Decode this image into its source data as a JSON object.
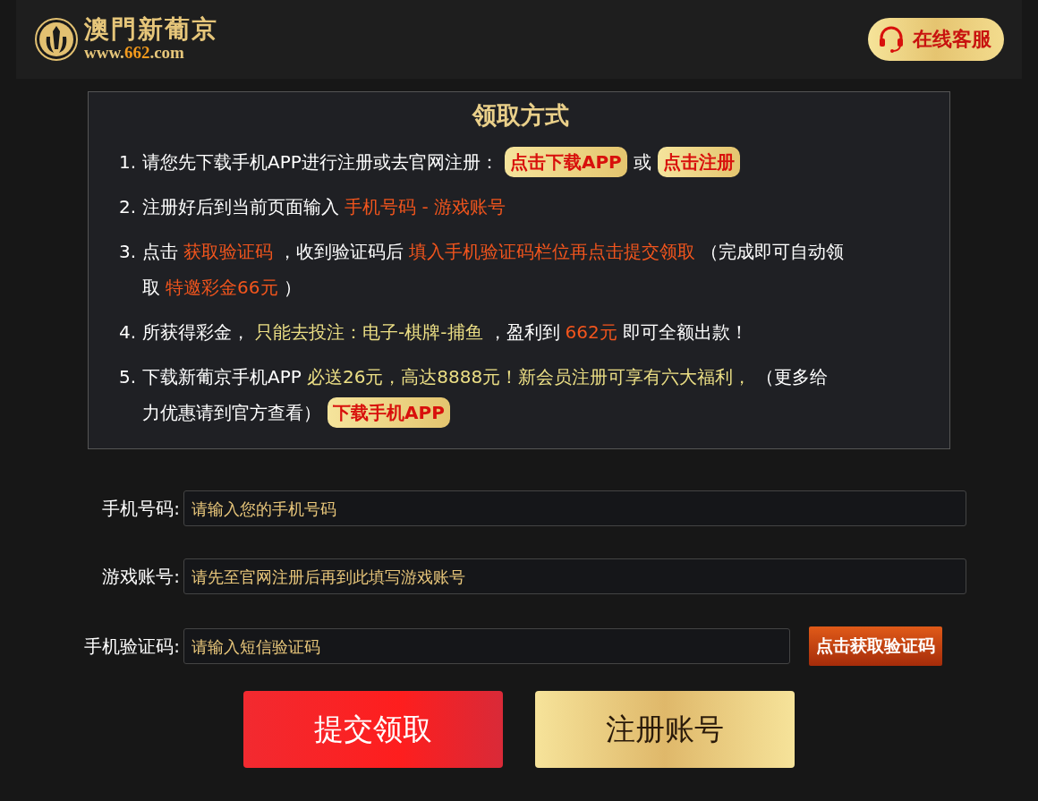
{
  "header": {
    "logo": {
      "name": "澳門新葡京",
      "url": [
        {
          "text": "www.",
          "kind": "plain"
        },
        {
          "text": "662",
          "kind": "accent"
        },
        {
          "text": ".com",
          "kind": "plain"
        }
      ]
    },
    "support_button": "在线客服"
  },
  "instructions": {
    "title": "领取方式",
    "steps": [
      {
        "number": "1.",
        "lines": [
          [
            {
              "kind": "plain",
              "text": "请您先下载手机APP进行注册或去官网注册："
            },
            {
              "kind": "button",
              "text": "点击下载APP"
            },
            {
              "kind": "plain",
              "text": "或"
            },
            {
              "kind": "button",
              "text": "点击注册"
            }
          ]
        ]
      },
      {
        "number": "2.",
        "lines": [
          [
            {
              "kind": "plain",
              "text": "注册好后到当前页面输入"
            },
            {
              "kind": "orange",
              "text": "手机号码 - 游戏账号"
            }
          ]
        ]
      },
      {
        "number": "3.",
        "lines": [
          [
            {
              "kind": "plain",
              "text": "点击"
            },
            {
              "kind": "orange",
              "text": "获取验证码"
            },
            {
              "kind": "plain",
              "text": "，收到验证码后"
            },
            {
              "kind": "orange",
              "text": "填入手机验证码栏位再点击提交领取"
            },
            {
              "kind": "plain",
              "text": "（完成即可自动领"
            }
          ],
          [
            {
              "kind": "plain",
              "text": "取"
            },
            {
              "kind": "orange",
              "text": "特邀彩金66元"
            },
            {
              "kind": "plain",
              "text": "）"
            }
          ]
        ]
      },
      {
        "number": "4.",
        "lines": [
          [
            {
              "kind": "plain",
              "text": "所获得彩金，"
            },
            {
              "kind": "yellow",
              "text": "只能去投注：电子-棋牌-捕鱼"
            },
            {
              "kind": "plain",
              "text": "，盈利到"
            },
            {
              "kind": "orange",
              "text": "662元"
            },
            {
              "kind": "plain",
              "text": "即可全额出款！"
            }
          ]
        ]
      },
      {
        "number": "5.",
        "lines": [
          [
            {
              "kind": "plain",
              "text": "下载新葡京手机APP"
            },
            {
              "kind": "yellow",
              "text": "必送26元，高达8888元！新会员注册可享有六大福利，"
            },
            {
              "kind": "plain",
              "text": "（更多给"
            }
          ],
          [
            {
              "kind": "plain",
              "text": "力优惠请到官方查看）"
            },
            {
              "kind": "button",
              "text": "下载手机APP"
            }
          ]
        ]
      }
    ]
  },
  "form": {
    "fields": [
      {
        "label": "手机号码:",
        "placeholder": "请输入您的手机号码"
      },
      {
        "label": "游戏账号:",
        "placeholder": "请先至官网注册后再到此填写游戏账号"
      },
      {
        "label": "手机验证码:",
        "placeholder": "请输入短信验证码",
        "button": "点击获取验证码"
      }
    ],
    "buttons": [
      {
        "kind": "primary",
        "label": "提交领取"
      },
      {
        "kind": "secondary",
        "label": "注册账号"
      }
    ]
  }
}
